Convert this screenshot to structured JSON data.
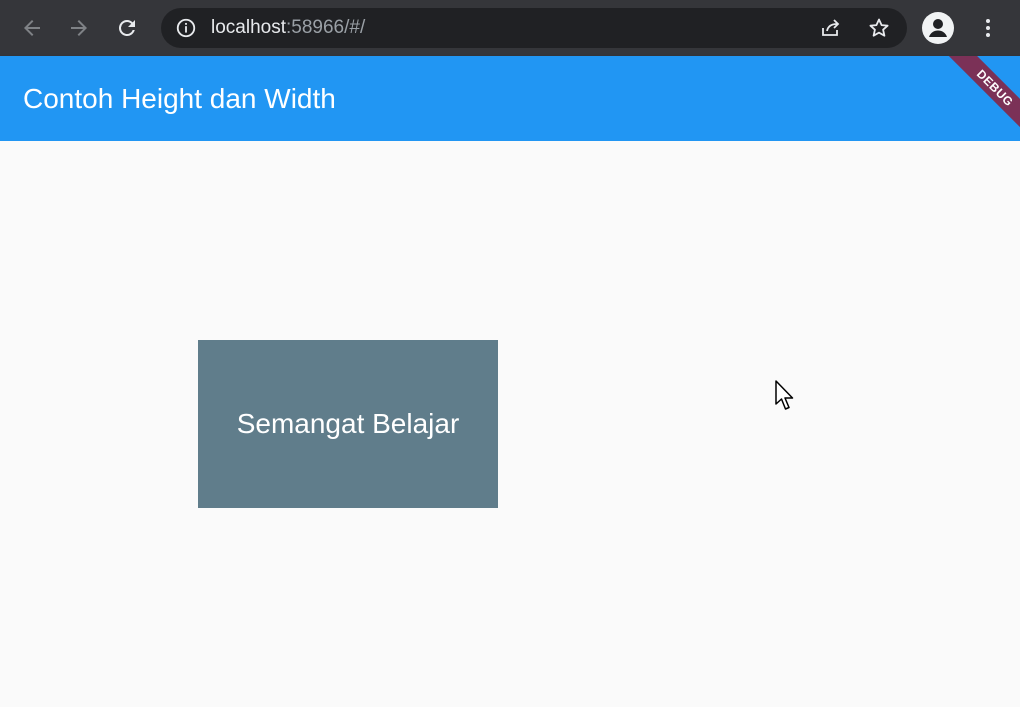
{
  "browser": {
    "url_host": "localhost",
    "url_rest": ":58966/#/"
  },
  "app": {
    "title": "Contoh Height dan Width",
    "debug_banner": "DEBUG"
  },
  "content": {
    "box_text": "Semangat Belajar"
  },
  "colors": {
    "browser_toolbar": "#35363a",
    "omnibox": "#202124",
    "app_bar": "#2196f3",
    "box": "#607d8b",
    "debug_banner": "#7b3157",
    "background": "#fafafa"
  },
  "icons": [
    "back-arrow-icon",
    "forward-arrow-icon",
    "reload-icon",
    "info-icon",
    "share-icon",
    "bookmark-star-icon",
    "profile-icon",
    "kebab-menu-icon",
    "mouse-cursor-icon"
  ]
}
